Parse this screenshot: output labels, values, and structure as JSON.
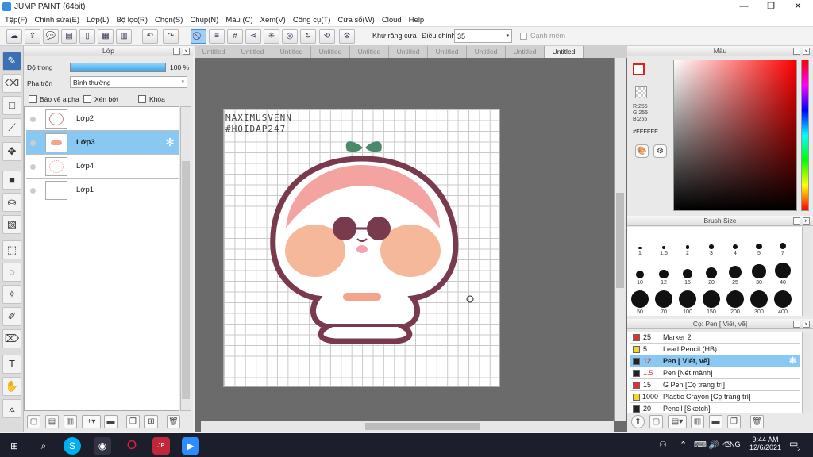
{
  "window": {
    "title": "JUMP PAINT (64bit)",
    "controls": [
      "—",
      "❐",
      "✕"
    ]
  },
  "menu": [
    "Tệp(F)",
    "Chỉnh sửa(E)",
    "Lớp(L)",
    "Bộ lọc(R)",
    "Chọn(S)",
    "Chụp(N)",
    "Màu (C)",
    "Xem(V)",
    "Công cụ(T)",
    "Cửa sổ(W)",
    "Cloud",
    "Help"
  ],
  "toolbar": {
    "antialias_label": "Khử răng cưa",
    "adjust_label": "Điều chỉnh",
    "adjust_value": "35",
    "snap_label": "Cạnh mềm"
  },
  "layer_panel": {
    "title": "Lớp",
    "opacity_label": "Độ trong",
    "opacity_value": "100 %",
    "opacity": 1.0,
    "blend_label": "Pha trộn",
    "blend_value": "Bình thường",
    "protect_alpha": "Bảo vệ alpha",
    "clip": "Xén bớt",
    "lock": "Khóa",
    "layers": [
      {
        "name": "Lớp2",
        "selected": false
      },
      {
        "name": "Lớp3",
        "selected": true
      },
      {
        "name": "Lớp4",
        "selected": false
      },
      {
        "name": "Lớp1",
        "selected": false
      }
    ]
  },
  "tabs": [
    "Untitled",
    "Untitled",
    "Untitled",
    "Untitled",
    "Untitled",
    "Untitled",
    "Untitled",
    "Untitled",
    "Untitled",
    "Untitled"
  ],
  "canvas": {
    "watermark_line1": "MAXIMUSVENN",
    "watermark_line2": "#HOIDAP247"
  },
  "color_panel": {
    "title": "Màu",
    "r": "R:255",
    "g": "G:255",
    "b": "B:255",
    "hex": "#FFFFFF"
  },
  "brush_size_panel": {
    "title": "Brush Size",
    "sizes": [
      "1",
      "1.5",
      "2",
      "3",
      "4",
      "5",
      "7",
      "10",
      "12",
      "15",
      "20",
      "25",
      "30",
      "40",
      "50",
      "70",
      "100",
      "150",
      "200",
      "300",
      "400"
    ]
  },
  "brush_panel": {
    "title": "Cọ: Pen [ Viết, vẽ]",
    "brushes": [
      {
        "size": "25",
        "name": "Marker 2",
        "color": "#e03030",
        "selected": false
      },
      {
        "size": "5",
        "name": "Lead Pencil (HB)",
        "color": "#f2d72a",
        "selected": false
      },
      {
        "size": "12",
        "name": "Pen [ Viết, vẽ]",
        "color": "#222222",
        "selected": true
      },
      {
        "size": "1.5",
        "name": "Pen [Nét mảnh]",
        "color": "#222222",
        "selected": false
      },
      {
        "size": "15",
        "name": "G Pen [Cọ trang trí]",
        "color": "#e03030",
        "selected": false
      },
      {
        "size": "1000",
        "name": "Plastic Crayon [Cọ trang trí]",
        "color": "#f2d72a",
        "selected": false
      },
      {
        "size": "20",
        "name": "Pencil [Sketch]",
        "color": "#222222",
        "selected": false
      }
    ]
  },
  "taskbar": {
    "language": "ENG",
    "time": "9:44 AM",
    "date": "12/6/2021",
    "notification_count": "2"
  },
  "colors": {
    "accent": "#3d8fd0",
    "selected_row": "#88c8f2",
    "canvas_bg": "#6b6b6b"
  }
}
